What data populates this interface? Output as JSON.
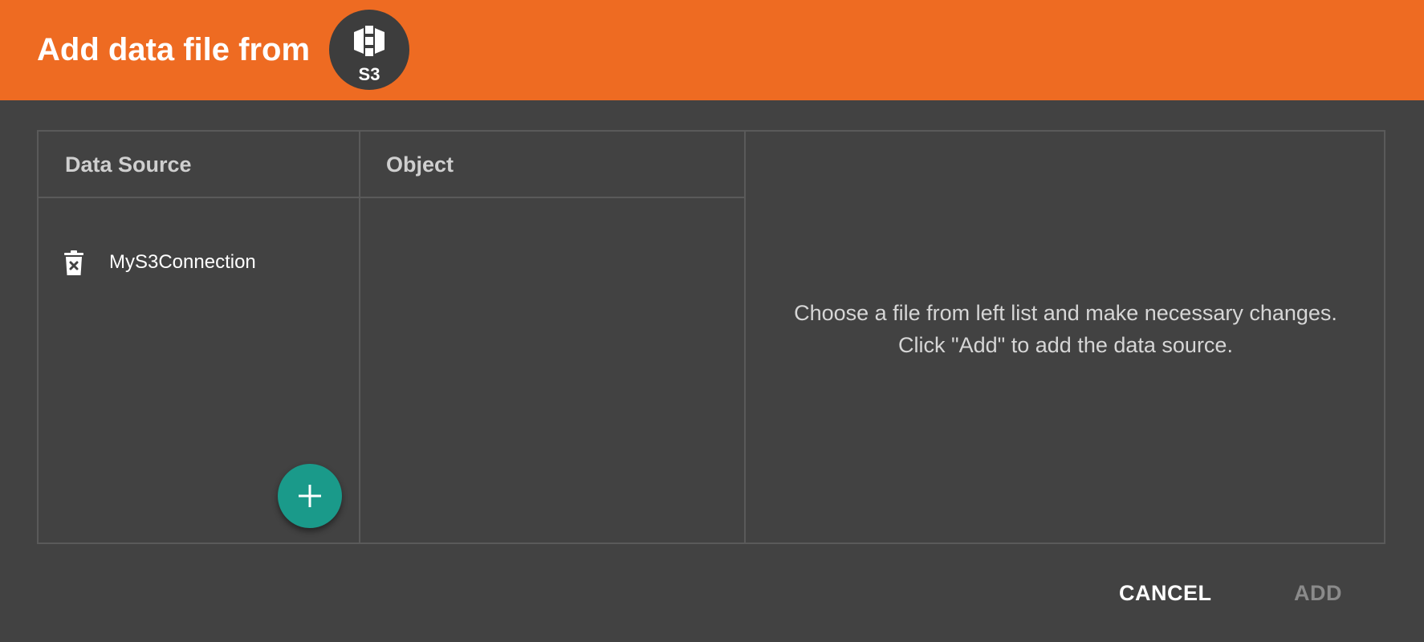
{
  "dialog": {
    "title": "Add data file from",
    "source_badge": {
      "icon": "aws-s3-icon",
      "label": "S3"
    },
    "accent_color": "#ee6b22",
    "fab_color": "#1a9a8a"
  },
  "columns": {
    "data_source_header": "Data Source",
    "object_header": "Object"
  },
  "data_sources": [
    {
      "label": "MyS3Connection",
      "icon": "delete-icon"
    }
  ],
  "add_source_button": {
    "icon": "plus-icon"
  },
  "hint": {
    "line1": "Choose a file from left list and make necessary changes.",
    "line2": "Click \"Add\" to add the data source."
  },
  "actions": {
    "cancel_label": "CANCEL",
    "add_label": "ADD",
    "add_enabled": false
  }
}
